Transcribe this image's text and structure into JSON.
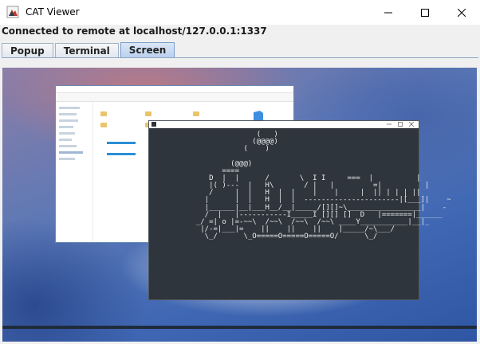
{
  "window": {
    "title": "CAT Viewer",
    "icon": "cat-app-icon",
    "controls": [
      "minimize-icon",
      "maximize-icon",
      "close-icon"
    ]
  },
  "status": {
    "text": "Connected to remote at localhost/127.0.0.1:1337"
  },
  "tabs": [
    {
      "label": "Popup",
      "active": false
    },
    {
      "label": "Terminal",
      "active": false
    },
    {
      "label": "Screen",
      "active": true
    }
  ],
  "remote_screen": {
    "terminal_art": "                (   )\n               (@@@@)\n             (    )\n\n          (@@@)\n        ====\n     D  |  |      /       \\  I I     ===  |          |\n     |( )---  |   H\\       / |   |         =|          |\n     /     |  |   H  |  |    |    |     |  || | | | ||\n    |      |  |   H  |  |  ----------------------|[___]|    ~\n    |______|__|___H__/__|_____/[][]~\\_________________|    -\n    /  |   |-----------I_____I [][] []  D   |=======|______\n  _/ =| o |=-~~\\  /~~\\  /~~\\  /~~\\ ____Y___________|__|_\n   |/-=|___|=    ||    ||    ||    |_____/~\\___/\n    \\_/      \\_O=====O=====O=====O/      \\_/",
    "accent_colors": {
      "terminal_bg": "#2f353c",
      "desktop_blue": "#3f67b3",
      "tab_active": "#b9cfee"
    }
  }
}
